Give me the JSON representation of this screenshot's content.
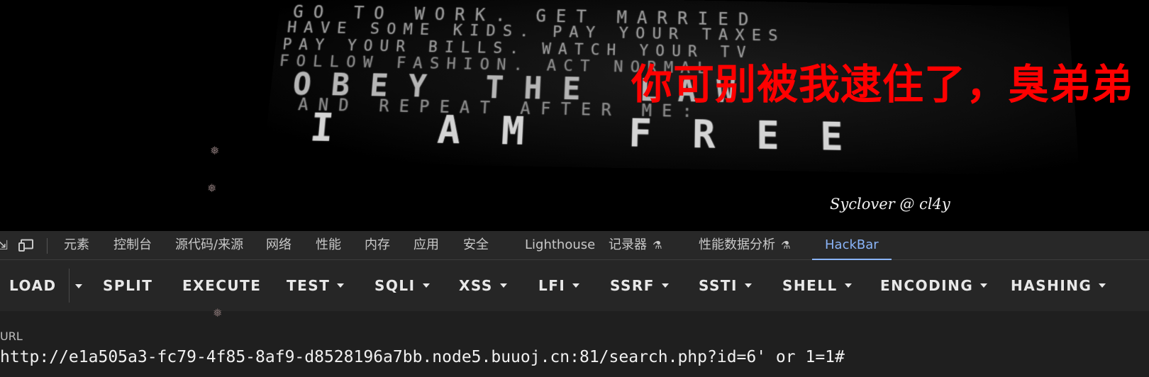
{
  "hero": {
    "poster_lines": [
      "GO TO WORK. GET MARRIED",
      "HAVE SOME KIDS. PAY YOUR TAXES",
      "PAY YOUR BILLS. WATCH YOUR TV",
      "FOLLOW FASHION. ACT NORMAL",
      "OBEY THE LAW",
      "AND REPEAT AFTER ME:",
      "I AM FREE"
    ],
    "overlay_text": "你可别被我逮住了，臭弟弟",
    "author": "Syclover @ cl4y",
    "overlay_color": "#ff0000"
  },
  "devtools": {
    "cut_icon_glyph": "⇲",
    "tabs": [
      {
        "label": "元素",
        "flask": false
      },
      {
        "label": "控制台",
        "flask": false
      },
      {
        "label": "源代码/来源",
        "flask": false
      },
      {
        "label": "网络",
        "flask": false
      },
      {
        "label": "性能",
        "flask": false
      },
      {
        "label": "内存",
        "flask": false
      },
      {
        "label": "应用",
        "flask": false
      },
      {
        "label": "安全",
        "flask": false
      },
      {
        "label": "Lighthouse",
        "flask": false
      },
      {
        "label": "记录器",
        "flask": true
      },
      {
        "label": "性能数据分析",
        "flask": true
      },
      {
        "label": "HackBar",
        "flask": false,
        "active": true
      }
    ],
    "active_color": "#8ab4f8"
  },
  "hackbar": {
    "buttons": [
      {
        "label": "LOAD",
        "dropdown": false
      },
      {
        "label": "SPLIT",
        "dropdown": false
      },
      {
        "label": "EXECUTE",
        "dropdown": false
      },
      {
        "label": "TEST",
        "dropdown": true
      },
      {
        "label": "SQLI",
        "dropdown": true
      },
      {
        "label": "XSS",
        "dropdown": true
      },
      {
        "label": "LFI",
        "dropdown": true
      },
      {
        "label": "SSRF",
        "dropdown": true
      },
      {
        "label": "SSTI",
        "dropdown": true
      },
      {
        "label": "SHELL",
        "dropdown": true
      },
      {
        "label": "ENCODING",
        "dropdown": true
      },
      {
        "label": "HASHING",
        "dropdown": true
      }
    ]
  },
  "url": {
    "label": "URL",
    "value": "http://e1a505a3-fc79-4f85-8af9-d8528196a7bb.node5.buuoj.cn:81/search.php?id=6' or 1=1#"
  }
}
